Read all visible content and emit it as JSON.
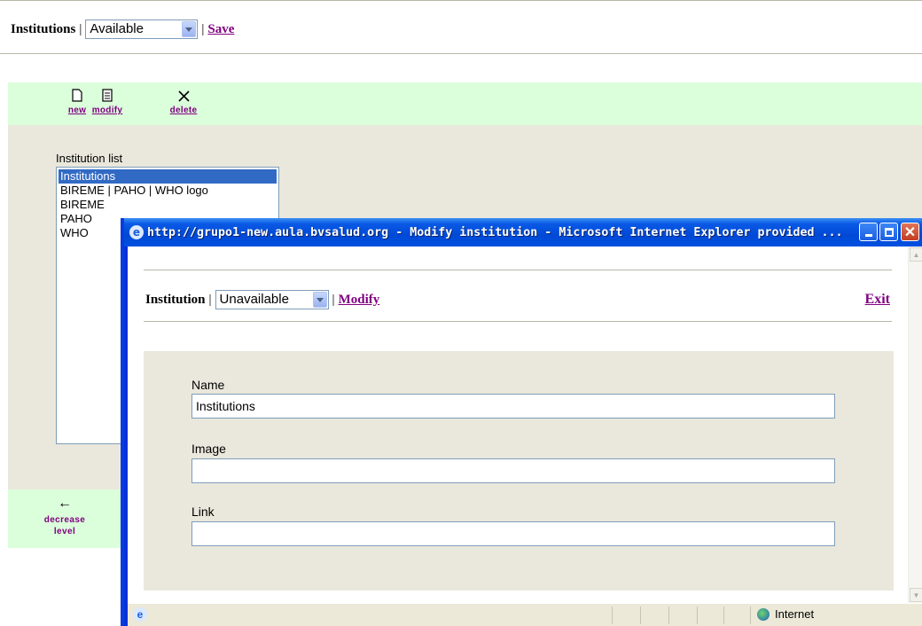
{
  "page": {
    "title": "Institutions",
    "separator": "|",
    "status_select": "Available",
    "save_label": "Save"
  },
  "toolbar": {
    "new_label": "new",
    "modify_label": "modify",
    "delete_label": "delete"
  },
  "list": {
    "label": "Institution list",
    "items": [
      "Institutions",
      "BIREME | PAHO | WHO logo",
      "BIREME",
      "PAHO",
      "WHO"
    ]
  },
  "bottom_nav": {
    "line1": "decrease",
    "line2": "level"
  },
  "popup": {
    "window_title": "http://grupo1-new.aula.bvsalud.org - Modify institution - Microsoft Internet Explorer provided ...",
    "heading": "Institution",
    "separator": "|",
    "status_select": "Unavailable",
    "modify_label": "Modify",
    "exit_label": "Exit",
    "form": {
      "name_label": "Name",
      "name_value": "Institutions",
      "image_label": "Image",
      "image_value": "",
      "link_label": "Link",
      "link_value": ""
    },
    "status_zone": "Internet"
  }
}
